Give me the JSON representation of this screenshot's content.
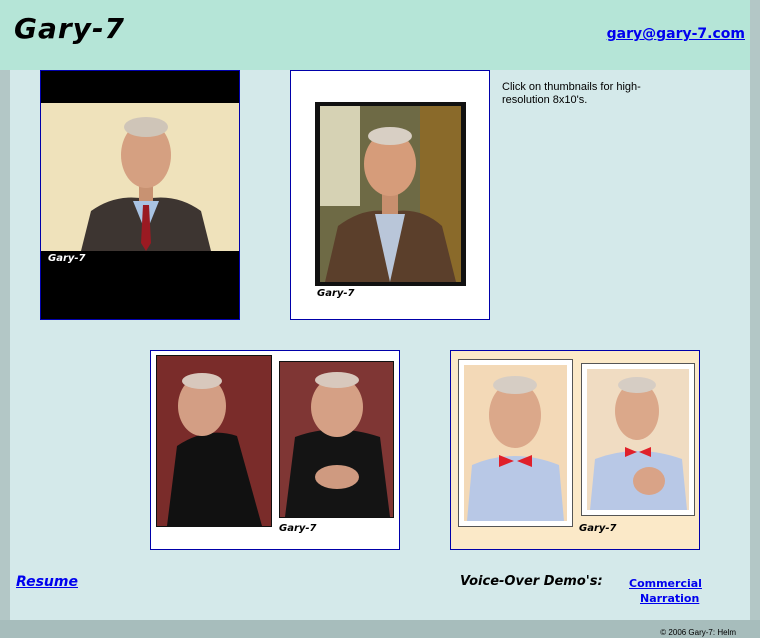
{
  "header": {
    "title": "Gary-7",
    "email": "gary@gary-7.com"
  },
  "instructions": "Click on thumbnails for high-resolution 8x10's.",
  "thumbnails": [
    {
      "caption": "Gary-7"
    },
    {
      "caption": "Gary-7"
    },
    {
      "caption": "Gary-7"
    },
    {
      "caption": "Gary-7"
    }
  ],
  "footer": {
    "resume_label": "Resume",
    "voiceover_label": "Voice-Over Demo's:",
    "commercial_label": "Commercial",
    "narration_label": "Narration",
    "copyright": "© 2006 Gary-7: Helm"
  },
  "colors": {
    "page_bg": "#d4e9ea",
    "header_bg": "#b5e5d7",
    "outer_bg": "#b3c7c6",
    "link": "#0000ee",
    "thumb_border": "#0000aa"
  }
}
